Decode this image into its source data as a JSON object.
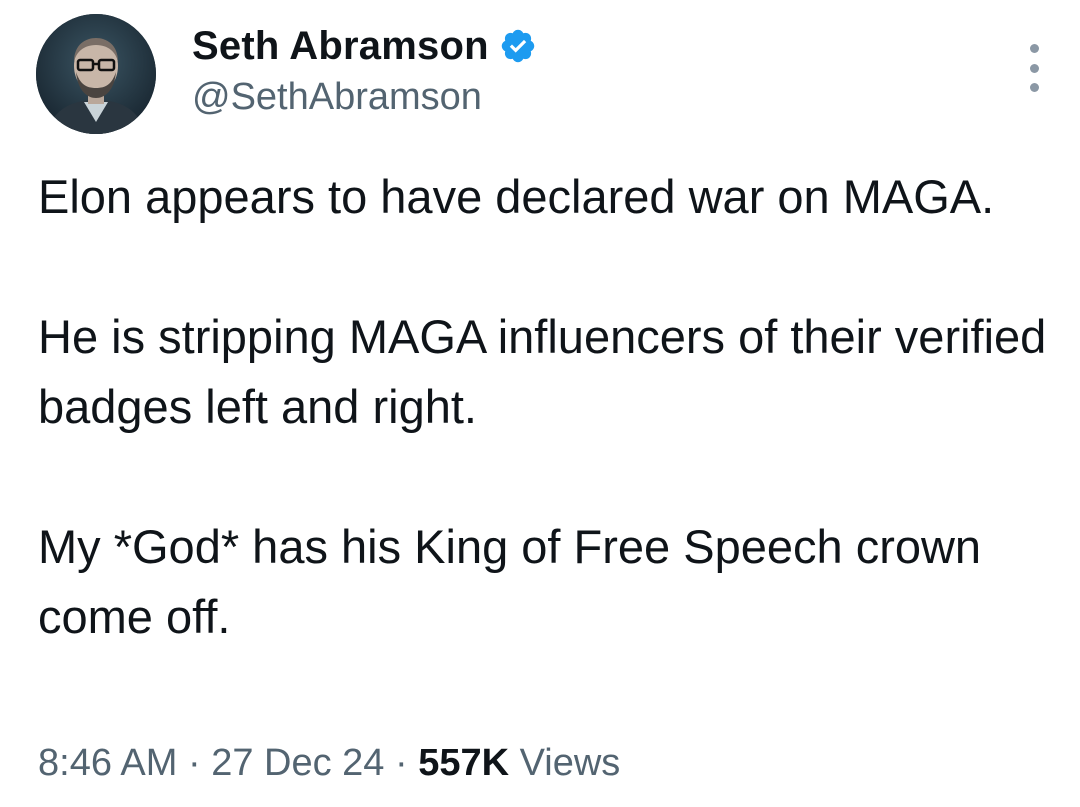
{
  "author": {
    "display_name": "Seth Abramson",
    "handle": "@SethAbramson",
    "verified": true,
    "verified_icon": "verified-badge-icon",
    "verified_color": "#1d9bf0"
  },
  "tweet": {
    "paragraphs": [
      "Elon appears to have declared war on MAGA.",
      "He is stripping MAGA influencers of their verified badges left and right.",
      "My *God* has his King of Free Speech crown come off."
    ]
  },
  "meta": {
    "time": "8:46 AM",
    "separator": "·",
    "date": "27 Dec 24",
    "views_count": "557K",
    "views_label": "Views"
  },
  "colors": {
    "text_primary": "#0f1419",
    "text_secondary": "#536471"
  },
  "icons": {
    "more": "more-options-icon"
  }
}
